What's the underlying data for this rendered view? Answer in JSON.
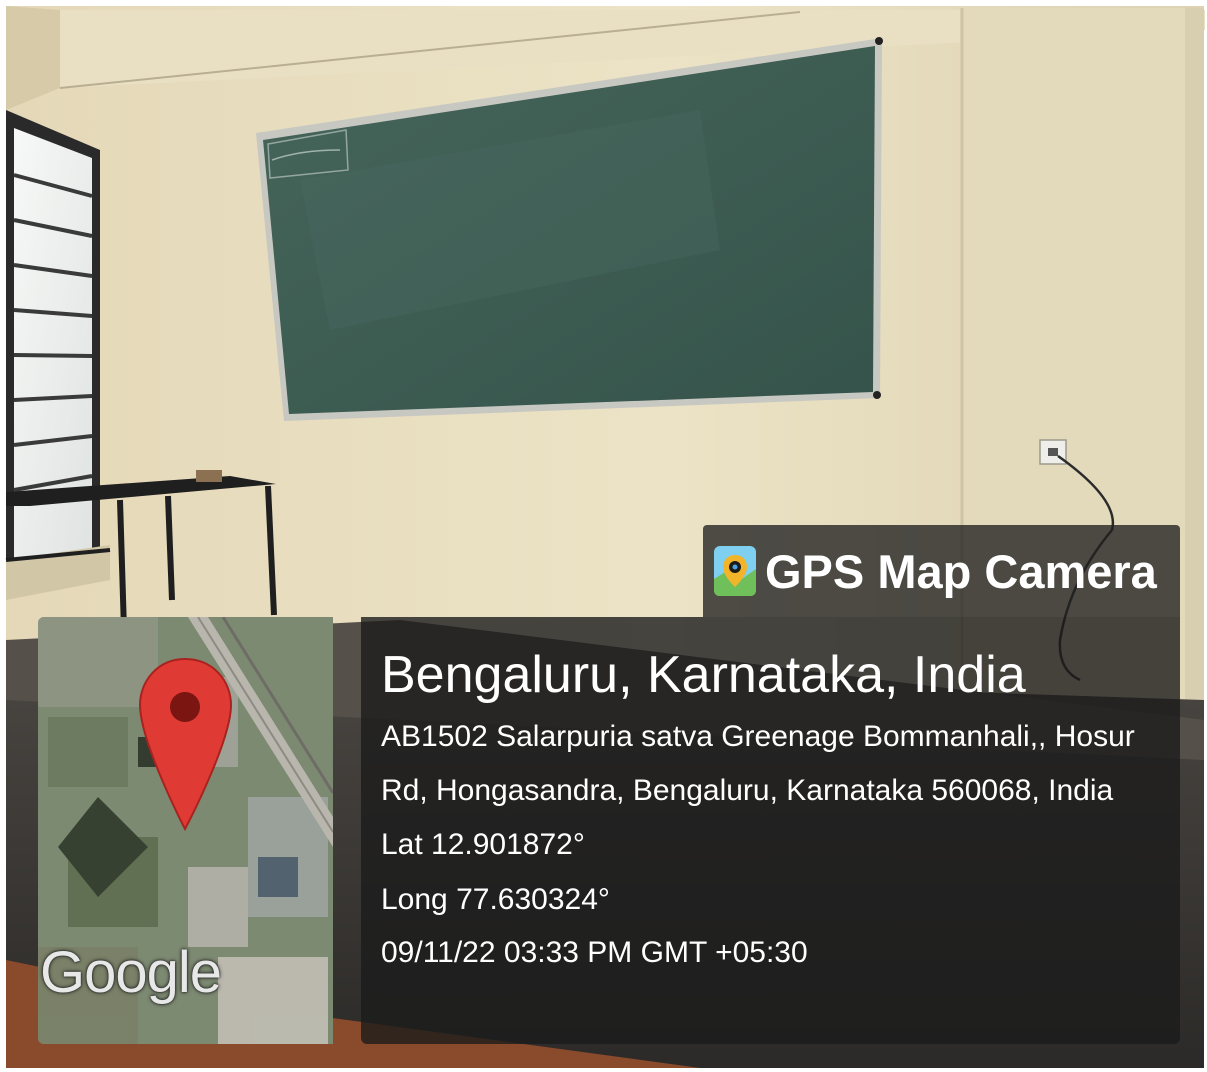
{
  "overlay": {
    "app_name": "GPS Map Camera",
    "location_title": "Bengaluru, Karnataka, India",
    "address_line1": "AB1502 Salarpuria satva Greenage Bommanhali,, Hosur",
    "address_line2": "Rd, Hongasandra, Bengaluru, Karnataka 560068, India",
    "latitude": "Lat 12.901872°",
    "longitude": "Long 77.630324°",
    "timestamp": "09/11/22 03:33 PM GMT +05:30"
  },
  "map": {
    "brand": "Google",
    "pin_icon": "map-pin-icon",
    "pin_color": "#e03a34"
  },
  "photo": {
    "wall_color": "#e7dcbc",
    "board_color": "#3f5e55",
    "board_frame_color": "#c9c9c4",
    "window_color": "#f0f2f1",
    "floor_color": "#3a3632",
    "desk_color": "#8a4b2c"
  }
}
